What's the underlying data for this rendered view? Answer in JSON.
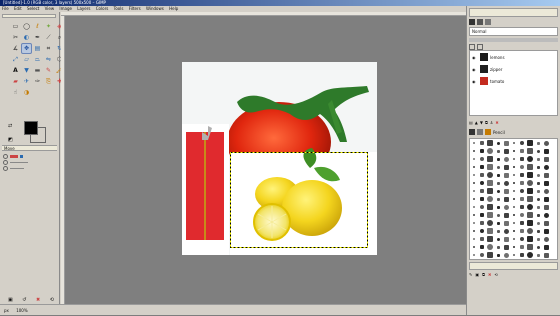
{
  "window": {
    "title": "[Untitled]-1.0 (RGB color, 3 layers) 500x500 – GIMP"
  },
  "menu": {
    "items": [
      "File",
      "Edit",
      "Select",
      "View",
      "Image",
      "Layers",
      "Colors",
      "Tools",
      "Filters",
      "Windows",
      "Help"
    ]
  },
  "toolbox": {
    "tools": [
      "rect-select",
      "ellipse-select",
      "free-select",
      "fuzzy-select",
      "color-select",
      "scissors",
      "foreground-select",
      "paths",
      "color-picker",
      "zoom",
      "measure",
      "move",
      "align",
      "crop",
      "rotate",
      "scale",
      "shear",
      "perspective",
      "flip",
      "cage",
      "text",
      "bucket-fill",
      "blend",
      "pencil",
      "paintbrush",
      "eraser",
      "airbrush",
      "ink",
      "clone",
      "heal",
      "smudge",
      "dodge-burn"
    ],
    "fg_color": "#000000",
    "bg_color": "#ffffff",
    "tool_options_label": "Move"
  },
  "layers": {
    "mode_label": "Normal",
    "items": [
      {
        "name": "lemons"
      },
      {
        "name": "zipper"
      },
      {
        "name": "tomato"
      }
    ]
  },
  "brushes": {
    "label": "Pencil"
  },
  "status": {
    "unit": "px",
    "zoom": "100%"
  },
  "colors": {
    "accent": "#0a246a"
  }
}
